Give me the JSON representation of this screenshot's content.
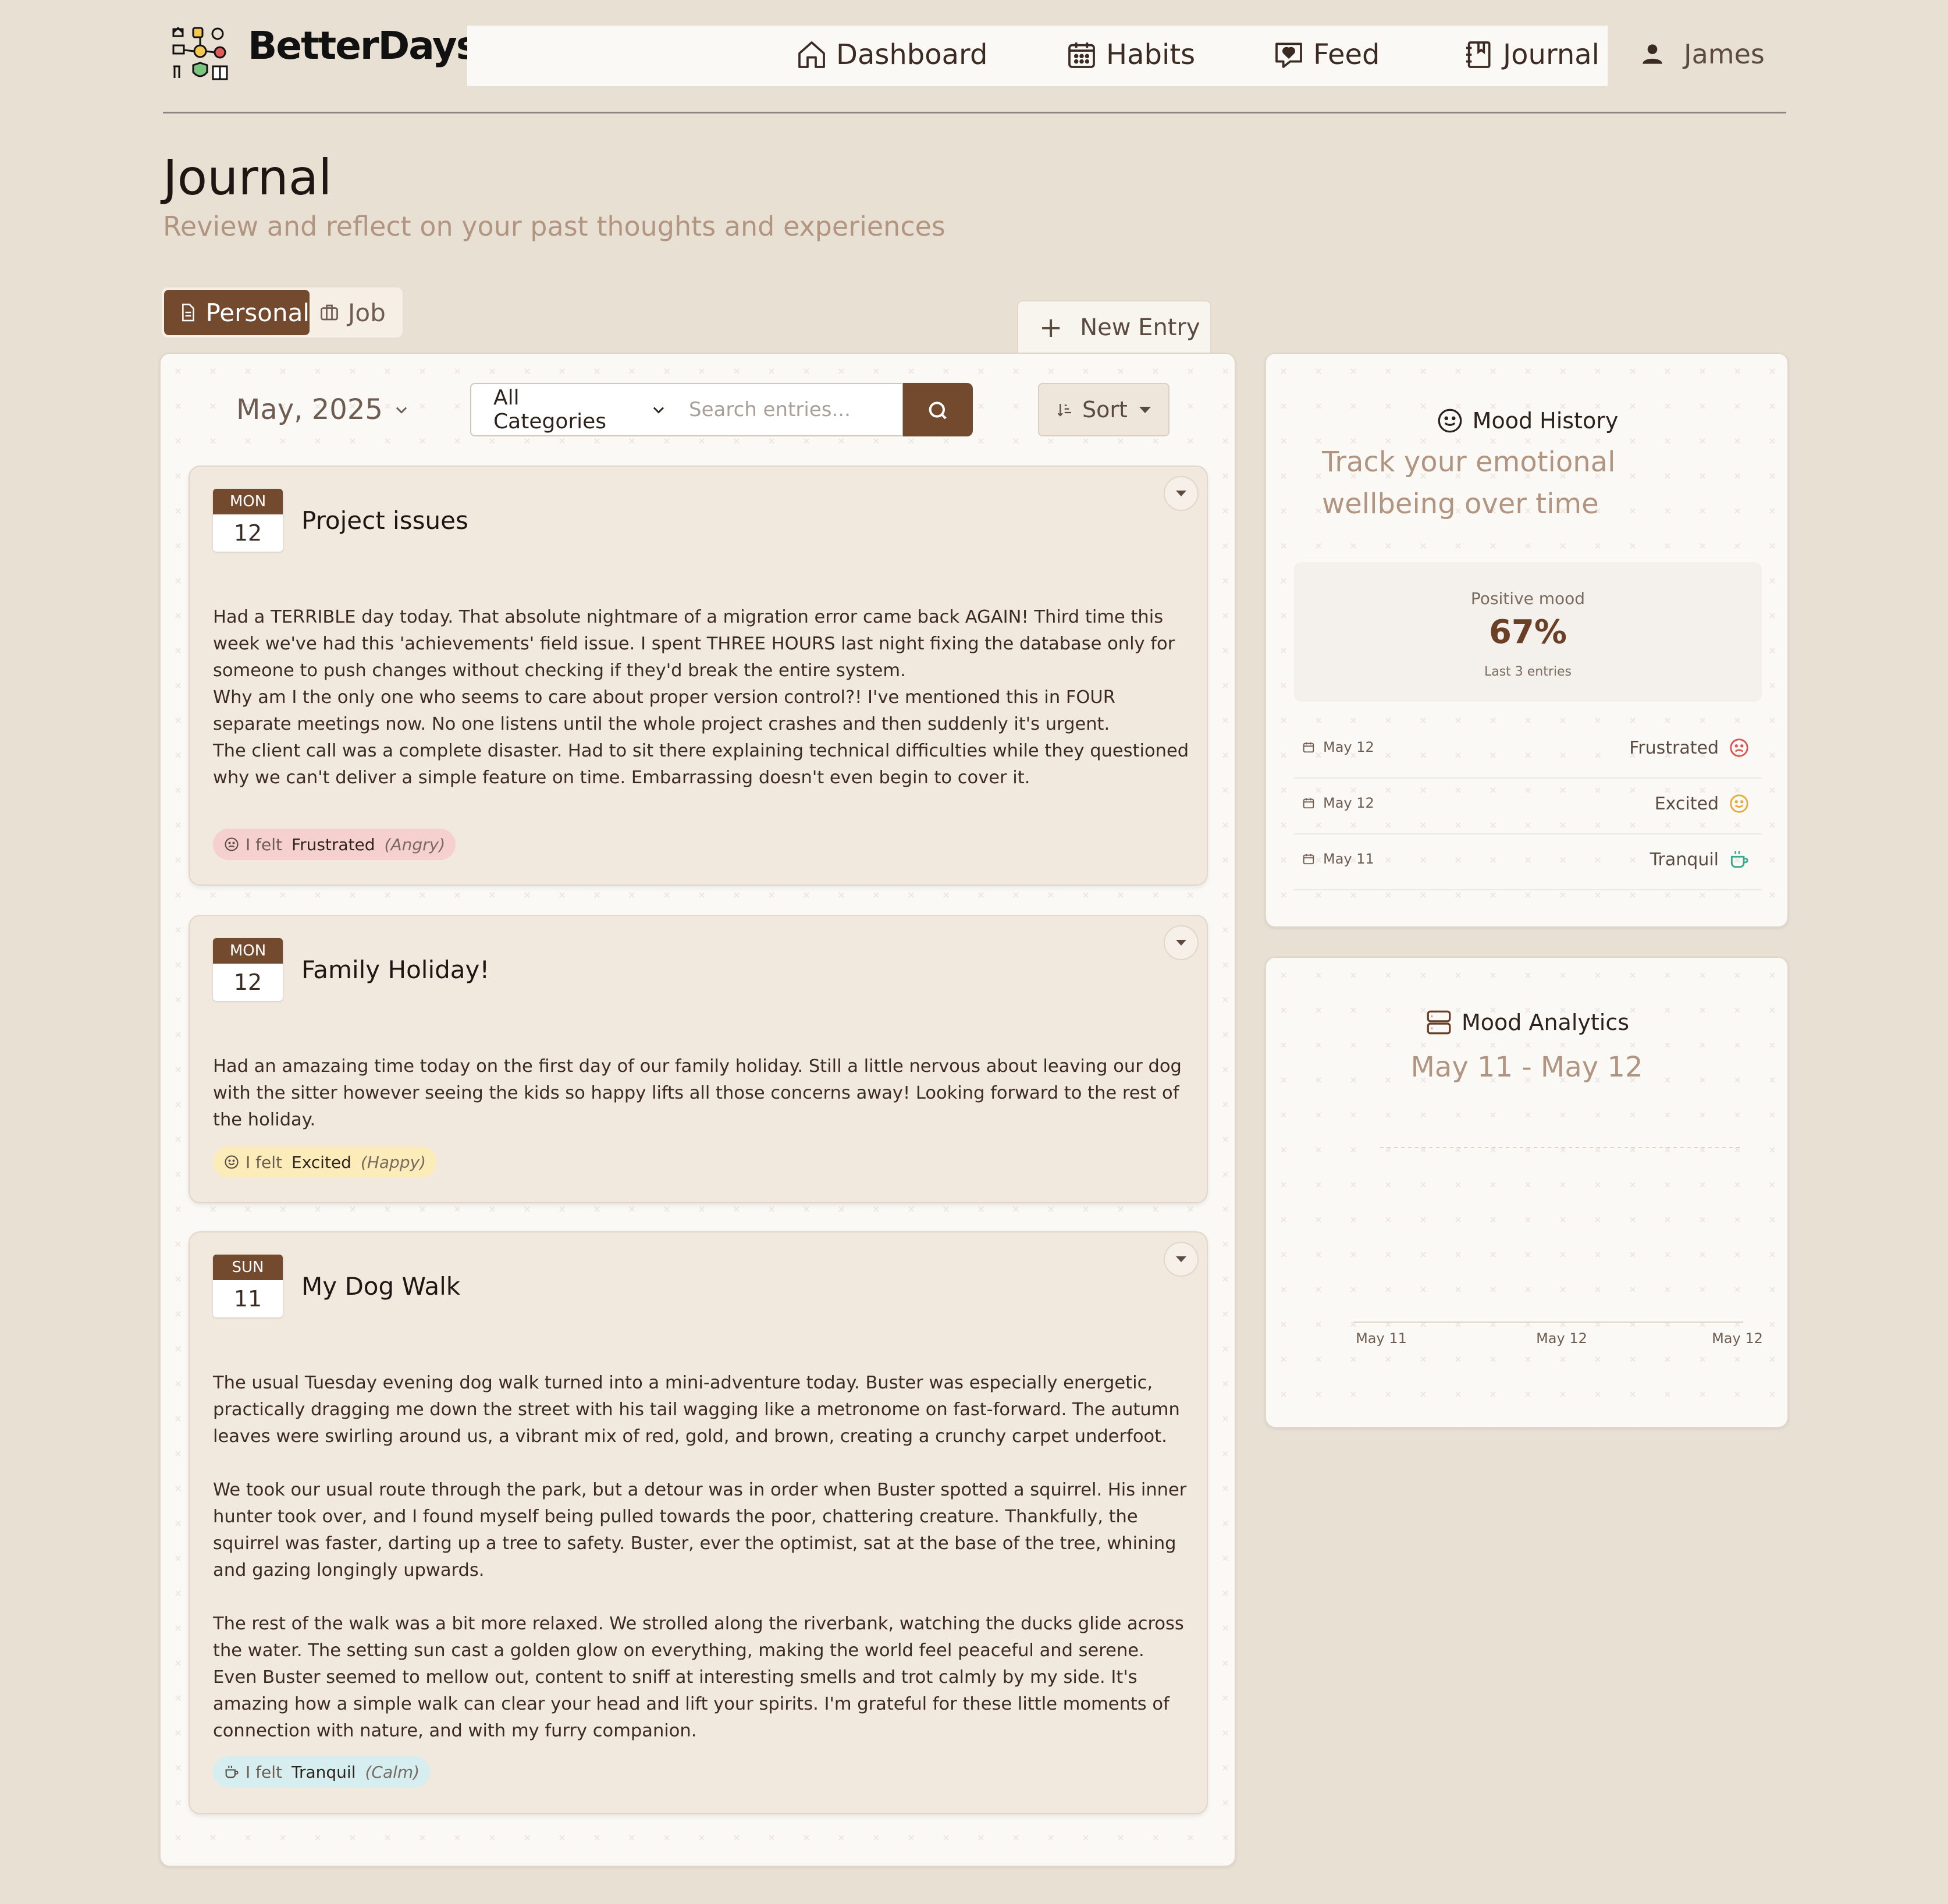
{
  "header": {
    "brand": "BetterDays",
    "nav": [
      {
        "label": "Dashboard",
        "icon": "home-icon"
      },
      {
        "label": "Habits",
        "icon": "calendar-grid-icon"
      },
      {
        "label": "Feed",
        "icon": "heart-message-icon"
      },
      {
        "label": "Journal",
        "icon": "notebook-icon"
      }
    ],
    "user": "James"
  },
  "page": {
    "title": "Journal",
    "subtitle": "Review and reflect on your past thoughts and experiences"
  },
  "tabs": [
    {
      "label": "Personal",
      "active": true,
      "icon": "document-icon"
    },
    {
      "label": "Job",
      "active": false,
      "icon": "briefcase-icon"
    }
  ],
  "new_entry_label": "New Entry",
  "toolbar": {
    "month": "May, 2025",
    "category": "All Categories",
    "search_placeholder": "Search entries...",
    "sort_label": "Sort"
  },
  "entries": [
    {
      "dow": "MON",
      "day": "12",
      "title": "Project issues",
      "body": "Had a TERRIBLE day today. That absolute nightmare of a migration error came back AGAIN! Third time this week we've had this 'achievements' field issue. I spent THREE HOURS last night fixing the database only for someone to push changes without checking if they'd break the entire system.\nWhy am I the only one who seems to care about proper version control?! I've mentioned this in FOUR separate meetings now. No one listens until the whole project crashes and then suddenly it's urgent.\nThe client call was a complete disaster. Had to sit there explaining technical difficulties while they questioned why we can't deliver a simple feature on time. Embarrassing doesn't even begin to cover it.",
      "felt_label": "I felt",
      "emotion": "Frustrated",
      "category": "(Angry)",
      "chip_color": "#f6cfcf",
      "icon": "frown-icon"
    },
    {
      "dow": "MON",
      "day": "12",
      "title": "Family Holiday!",
      "body": "Had an amazaing time today on the first day of our family holiday. Still a little nervous about leaving our dog with the sitter however seeing the kids so happy lifts all those concerns away! Looking forward to the rest of the holiday.",
      "felt_label": "I felt",
      "emotion": "Excited",
      "category": "(Happy)",
      "chip_color": "#fbecb9",
      "icon": "smile-icon"
    },
    {
      "dow": "SUN",
      "day": "11",
      "title": "My Dog Walk",
      "body": "The usual Tuesday evening dog walk turned into a mini-adventure today. Buster was especially energetic, practically dragging me down the street with his tail wagging like a metronome on fast-forward. The autumn leaves were swirling around us, a vibrant mix of red, gold, and brown, creating a crunchy carpet underfoot.\n\nWe took our usual route through the park, but a detour was in order when Buster spotted a squirrel. His inner hunter took over, and I found myself being pulled towards the poor, chattering creature. Thankfully, the squirrel was faster, darting up a tree to safety. Buster, ever the optimist, sat at the base of the tree, whining and gazing longingly upwards.\n\nThe rest of the walk was a bit more relaxed. We strolled along the riverbank, watching the ducks glide across the water. The setting sun cast a golden glow on everything, making the world feel peaceful and serene. Even Buster seemed to mellow out, content to sniff at interesting smells and trot calmly by my side. It's amazing how a simple walk can clear your head and lift your spirits. I'm grateful for these little moments of connection with nature, and with my furry companion.",
      "felt_label": "I felt",
      "emotion": "Tranquil",
      "category": "(Calm)",
      "chip_color": "#d7eef0",
      "icon": "cup-icon"
    }
  ],
  "mood_history": {
    "title": "Mood History",
    "subtitle": "Track your emotional wellbeing over time",
    "positive_label": "Positive mood",
    "positive_value": "67%",
    "entries_label": "Last 3 entries",
    "rows": [
      {
        "date": "May 12",
        "mood": "Frustrated",
        "color": "#d9534f",
        "icon": "frown-icon"
      },
      {
        "date": "May 12",
        "mood": "Excited",
        "color": "#e8a93a",
        "icon": "smile-icon"
      },
      {
        "date": "May 11",
        "mood": "Tranquil",
        "color": "#3aa88a",
        "icon": "cup-icon"
      }
    ]
  },
  "mood_analytics": {
    "title": "Mood Analytics",
    "range": "May 11 - May 12",
    "x_labels": [
      "May 11",
      "May 12",
      "May 12"
    ]
  },
  "colors": {
    "accent": "#744a2e",
    "background": "#e9e0d4",
    "muted_text": "#b29580"
  }
}
